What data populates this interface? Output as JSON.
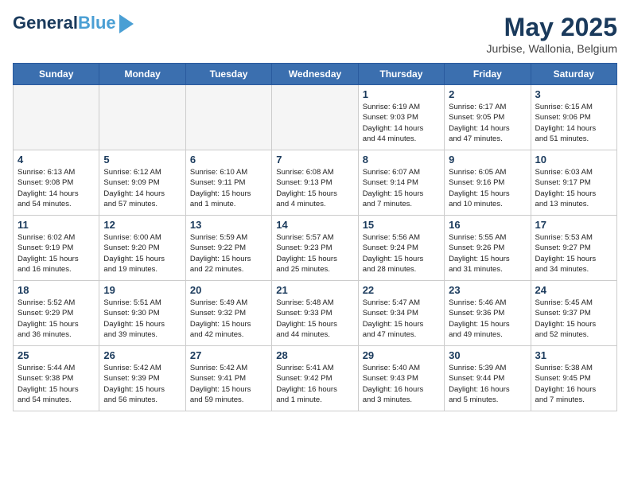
{
  "logo": {
    "line1": "General",
    "line2": "Blue"
  },
  "title": "May 2025",
  "subtitle": "Jurbise, Wallonia, Belgium",
  "weekdays": [
    "Sunday",
    "Monday",
    "Tuesday",
    "Wednesday",
    "Thursday",
    "Friday",
    "Saturday"
  ],
  "weeks": [
    [
      {
        "day": "",
        "info": ""
      },
      {
        "day": "",
        "info": ""
      },
      {
        "day": "",
        "info": ""
      },
      {
        "day": "",
        "info": ""
      },
      {
        "day": "1",
        "info": "Sunrise: 6:19 AM\nSunset: 9:03 PM\nDaylight: 14 hours\nand 44 minutes."
      },
      {
        "day": "2",
        "info": "Sunrise: 6:17 AM\nSunset: 9:05 PM\nDaylight: 14 hours\nand 47 minutes."
      },
      {
        "day": "3",
        "info": "Sunrise: 6:15 AM\nSunset: 9:06 PM\nDaylight: 14 hours\nand 51 minutes."
      }
    ],
    [
      {
        "day": "4",
        "info": "Sunrise: 6:13 AM\nSunset: 9:08 PM\nDaylight: 14 hours\nand 54 minutes."
      },
      {
        "day": "5",
        "info": "Sunrise: 6:12 AM\nSunset: 9:09 PM\nDaylight: 14 hours\nand 57 minutes."
      },
      {
        "day": "6",
        "info": "Sunrise: 6:10 AM\nSunset: 9:11 PM\nDaylight: 15 hours\nand 1 minute."
      },
      {
        "day": "7",
        "info": "Sunrise: 6:08 AM\nSunset: 9:13 PM\nDaylight: 15 hours\nand 4 minutes."
      },
      {
        "day": "8",
        "info": "Sunrise: 6:07 AM\nSunset: 9:14 PM\nDaylight: 15 hours\nand 7 minutes."
      },
      {
        "day": "9",
        "info": "Sunrise: 6:05 AM\nSunset: 9:16 PM\nDaylight: 15 hours\nand 10 minutes."
      },
      {
        "day": "10",
        "info": "Sunrise: 6:03 AM\nSunset: 9:17 PM\nDaylight: 15 hours\nand 13 minutes."
      }
    ],
    [
      {
        "day": "11",
        "info": "Sunrise: 6:02 AM\nSunset: 9:19 PM\nDaylight: 15 hours\nand 16 minutes."
      },
      {
        "day": "12",
        "info": "Sunrise: 6:00 AM\nSunset: 9:20 PM\nDaylight: 15 hours\nand 19 minutes."
      },
      {
        "day": "13",
        "info": "Sunrise: 5:59 AM\nSunset: 9:22 PM\nDaylight: 15 hours\nand 22 minutes."
      },
      {
        "day": "14",
        "info": "Sunrise: 5:57 AM\nSunset: 9:23 PM\nDaylight: 15 hours\nand 25 minutes."
      },
      {
        "day": "15",
        "info": "Sunrise: 5:56 AM\nSunset: 9:24 PM\nDaylight: 15 hours\nand 28 minutes."
      },
      {
        "day": "16",
        "info": "Sunrise: 5:55 AM\nSunset: 9:26 PM\nDaylight: 15 hours\nand 31 minutes."
      },
      {
        "day": "17",
        "info": "Sunrise: 5:53 AM\nSunset: 9:27 PM\nDaylight: 15 hours\nand 34 minutes."
      }
    ],
    [
      {
        "day": "18",
        "info": "Sunrise: 5:52 AM\nSunset: 9:29 PM\nDaylight: 15 hours\nand 36 minutes."
      },
      {
        "day": "19",
        "info": "Sunrise: 5:51 AM\nSunset: 9:30 PM\nDaylight: 15 hours\nand 39 minutes."
      },
      {
        "day": "20",
        "info": "Sunrise: 5:49 AM\nSunset: 9:32 PM\nDaylight: 15 hours\nand 42 minutes."
      },
      {
        "day": "21",
        "info": "Sunrise: 5:48 AM\nSunset: 9:33 PM\nDaylight: 15 hours\nand 44 minutes."
      },
      {
        "day": "22",
        "info": "Sunrise: 5:47 AM\nSunset: 9:34 PM\nDaylight: 15 hours\nand 47 minutes."
      },
      {
        "day": "23",
        "info": "Sunrise: 5:46 AM\nSunset: 9:36 PM\nDaylight: 15 hours\nand 49 minutes."
      },
      {
        "day": "24",
        "info": "Sunrise: 5:45 AM\nSunset: 9:37 PM\nDaylight: 15 hours\nand 52 minutes."
      }
    ],
    [
      {
        "day": "25",
        "info": "Sunrise: 5:44 AM\nSunset: 9:38 PM\nDaylight: 15 hours\nand 54 minutes."
      },
      {
        "day": "26",
        "info": "Sunrise: 5:42 AM\nSunset: 9:39 PM\nDaylight: 15 hours\nand 56 minutes."
      },
      {
        "day": "27",
        "info": "Sunrise: 5:42 AM\nSunset: 9:41 PM\nDaylight: 15 hours\nand 59 minutes."
      },
      {
        "day": "28",
        "info": "Sunrise: 5:41 AM\nSunset: 9:42 PM\nDaylight: 16 hours\nand 1 minute."
      },
      {
        "day": "29",
        "info": "Sunrise: 5:40 AM\nSunset: 9:43 PM\nDaylight: 16 hours\nand 3 minutes."
      },
      {
        "day": "30",
        "info": "Sunrise: 5:39 AM\nSunset: 9:44 PM\nDaylight: 16 hours\nand 5 minutes."
      },
      {
        "day": "31",
        "info": "Sunrise: 5:38 AM\nSunset: 9:45 PM\nDaylight: 16 hours\nand 7 minutes."
      }
    ]
  ]
}
